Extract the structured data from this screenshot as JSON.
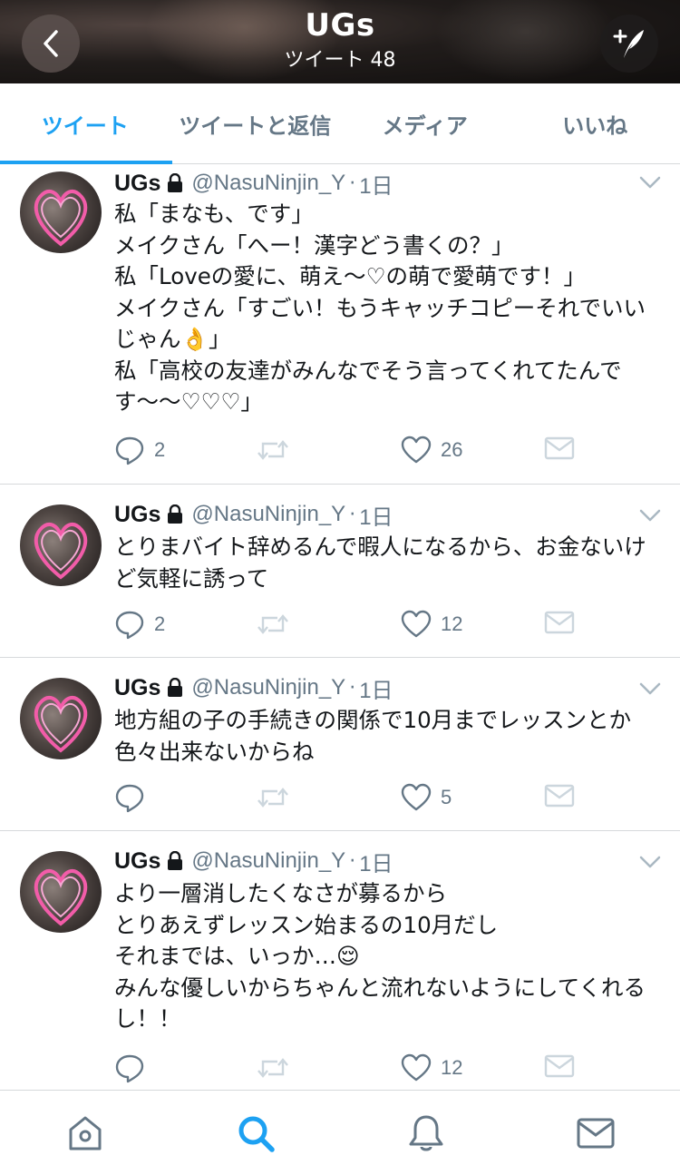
{
  "header": {
    "title": "UGs",
    "subtitle": "ツイート 48",
    "back_icon": "chevron-left-icon",
    "compose_icon": "compose-tweet-icon"
  },
  "tabs": [
    {
      "label": "ツイート",
      "active": true
    },
    {
      "label": "ツイートと返信",
      "active": false
    },
    {
      "label": "メディア",
      "active": false
    },
    {
      "label": "いいね",
      "active": false
    }
  ],
  "tweets": [
    {
      "name": "UGs",
      "handle": "@NasuNinjin_Y",
      "dot": "·",
      "time": "1日",
      "text": "私「まなも、です」\nメイクさん「へー！漢字どう書くの？」\n私「Loveの愛に、萌え〜♡の萌で愛萌です！」\nメイクさん「すごい！もうキャッチコピーそれでいいじゃん👌」\n私「高校の友達がみんなでそう言ってくれてたんです〜〜♡♡♡」",
      "replies": "2",
      "retweets": "",
      "likes": "26"
    },
    {
      "name": "UGs",
      "handle": "@NasuNinjin_Y",
      "dot": "·",
      "time": "1日",
      "text": "とりまバイト辞めるんで暇人になるから、お金ないけど気軽に誘って",
      "replies": "2",
      "retweets": "",
      "likes": "12"
    },
    {
      "name": "UGs",
      "handle": "@NasuNinjin_Y",
      "dot": "·",
      "time": "1日",
      "text": "地方組の子の手続きの関係で10月までレッスンとか色々出来ないからね",
      "replies": "",
      "retweets": "",
      "likes": "5"
    },
    {
      "name": "UGs",
      "handle": "@NasuNinjin_Y",
      "dot": "·",
      "time": "1日",
      "text": "より一層消したくなさが募るから\nとりあえずレッスン始まるの10月だし\nそれまでは、いっか…😌\nみんな優しいからちゃんと流れないようにしてくれるし！！",
      "replies": "",
      "retweets": "",
      "likes": "12"
    }
  ],
  "bottom_nav": [
    {
      "icon": "home-icon",
      "active": false
    },
    {
      "icon": "search-icon",
      "active": true
    },
    {
      "icon": "notifications-bell-icon",
      "active": false
    },
    {
      "icon": "messages-envelope-icon",
      "active": false
    }
  ],
  "colors": {
    "accent": "#1da1f2",
    "secondary_text": "#657786",
    "divider": "#d6d9db",
    "heart_pink": "#f25ca9"
  }
}
